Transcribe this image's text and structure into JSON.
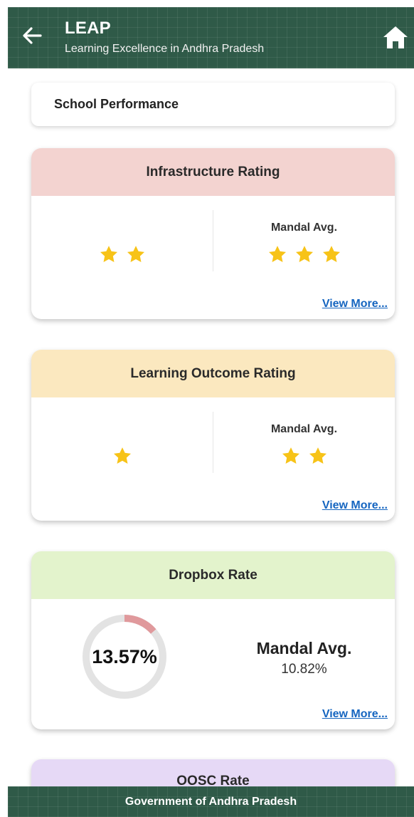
{
  "header": {
    "title": "LEAP",
    "subtitle": "Learning Excellence in Andhra Pradesh",
    "back_icon": "arrow-left-icon",
    "home_icon": "home-icon"
  },
  "section": {
    "title": "School Performance"
  },
  "infrastructure": {
    "title": "Infrastructure Rating",
    "header_color": "#f3d3d0",
    "school_stars": 2,
    "mandal_label": "Mandal Avg.",
    "mandal_stars": 3,
    "view_more": "View More..."
  },
  "learning": {
    "title": "Learning Outcome Rating",
    "header_color": "#fbe8bf",
    "school_stars": 1,
    "mandal_label": "Mandal Avg.",
    "mandal_stars": 2,
    "view_more": "View More..."
  },
  "dropbox": {
    "title": "Dropbox Rate",
    "header_color": "#e3f3cc",
    "school_rate": "13.57%",
    "school_rate_value": 13.57,
    "mandal_label": "Mandal Avg.",
    "mandal_rate": "10.82%",
    "view_more": "View More..."
  },
  "oosc": {
    "title": "OOSC Rate",
    "header_color": "#e6d9f6"
  },
  "footer": {
    "text": "Government of Andhra Pradesh"
  },
  "colors": {
    "brand": "#2f5a48",
    "star": "#f7c318",
    "link": "#1565c0",
    "donut_fill": "#e0999c",
    "donut_track": "#e3e3e3"
  }
}
